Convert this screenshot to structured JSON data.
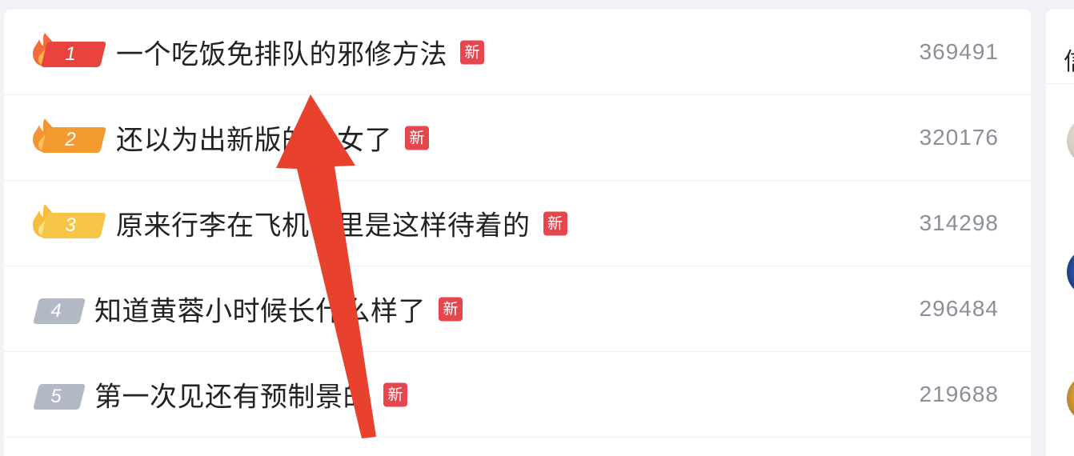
{
  "hot_list": {
    "items": [
      {
        "rank": "1",
        "title": "一个吃饭免排队的邪修方法",
        "badge": "新",
        "heat": "369491",
        "tag_color": "#e8433e",
        "flame": true
      },
      {
        "rank": "2",
        "title": "还以为出新版的儿女了",
        "badge": "新",
        "heat": "320176",
        "tag_color": "#f39a31",
        "flame": true
      },
      {
        "rank": "3",
        "title": "原来行李在飞机子里是这样待着的",
        "badge": "新",
        "heat": "314298",
        "tag_color": "#f6c545",
        "flame": true
      },
      {
        "rank": "4",
        "title": "知道黄蓉小时候长什么样了",
        "badge": "新",
        "heat": "296484",
        "tag_color": "#b3b8c6",
        "flame": false
      },
      {
        "rank": "5",
        "title": "第一次见还有预制景的",
        "badge": "新",
        "heat": "219688",
        "tag_color": "#b3b8c6",
        "flame": false
      }
    ]
  },
  "side_panel": {
    "heading": "信"
  },
  "colors": {
    "new_badge": "#e5474f",
    "annotation_arrow": "#e8412e",
    "heat_text": "#8a8f99"
  },
  "icons": {
    "flame": "flame-icon",
    "arrow": "annotation-arrow"
  }
}
